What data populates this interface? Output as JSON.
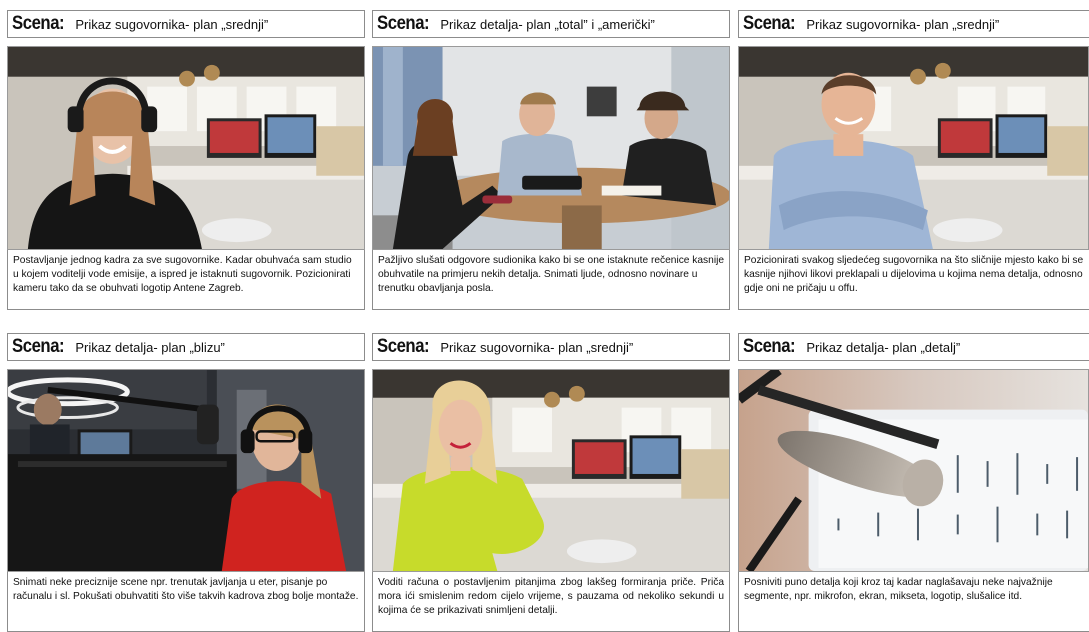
{
  "scene_label": "Scena:",
  "panels": [
    {
      "title": "Prikaz sugovornika- plan „srednji”",
      "caption": "Postavljanje jednog kadra za sve sugovornike. Kadar obuhvaća sam studio u kojem voditelji vode emisije, a ispred je istaknuti sugovornik. Pozicionirati kameru tako da se obuhvati logotip Antene Zagreb."
    },
    {
      "title": "Prikaz detalja- plan „total” i „američki”",
      "caption": "Pažljivo slušati odgovore sudionika kako bi se one istaknute rečenice kasnije obuhvatile na primjeru nekih detalja. Snimati ljude, odnosno novinare u trenutku obavljanja posla."
    },
    {
      "title": "Prikaz sugovornika- plan „srednji”",
      "caption": "Pozicionirati svakog sljedećeg sugovornika na što sličnije mjesto kako bi se kasnije njihovi likovi preklapali u dijelovima u kojima nema detalja, odnosno gdje oni ne pričaju u offu."
    },
    {
      "title": "Prikaz detalja- plan „blizu”",
      "caption": "Snimati neke preciznije scene npr. trenutak javljanja u eter, pisanje po računalu i sl. Pokušati obuhvatiti što više takvih kadrova zbog bolje montaže."
    },
    {
      "title": "Prikaz sugovornika- plan „srednji”",
      "caption": "Voditi računa o postavljenim pitanjima zbog lakšeg formiranja priče. Priča mora ići smislenim redom cijelo vrijeme, s pauzama od nekoliko sekundi u kojima će se prikazivati snimljeni detalji."
    },
    {
      "title": "Prikaz detalja- plan „detalj”",
      "caption": "Posniviti puno detalja koji kroz taj kadar naglašavaju neke najvažnije segmente, npr. mikrofon, ekran, mikseta, logotip, slušalice itd."
    }
  ]
}
